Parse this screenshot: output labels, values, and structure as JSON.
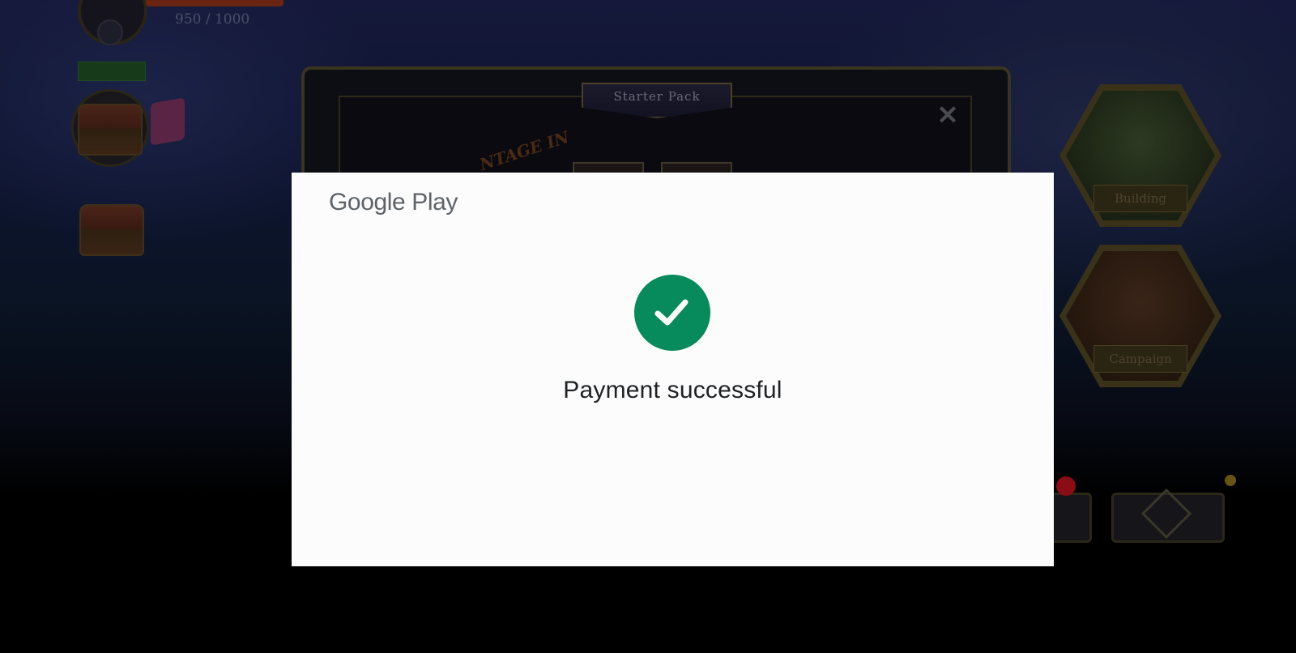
{
  "game": {
    "xp_text": "950 / 1000",
    "starter_pack": {
      "title": "Starter Pack",
      "close_glyph": "✕",
      "promo_text": "NTAGE IN"
    },
    "hex_buttons": [
      {
        "label": "Building"
      },
      {
        "label": "Campaign"
      }
    ]
  },
  "dialog": {
    "brand": "Google Play",
    "status_icon": "checkmark-circle-icon",
    "status_color": "#078a5c",
    "message": "Payment successful"
  }
}
